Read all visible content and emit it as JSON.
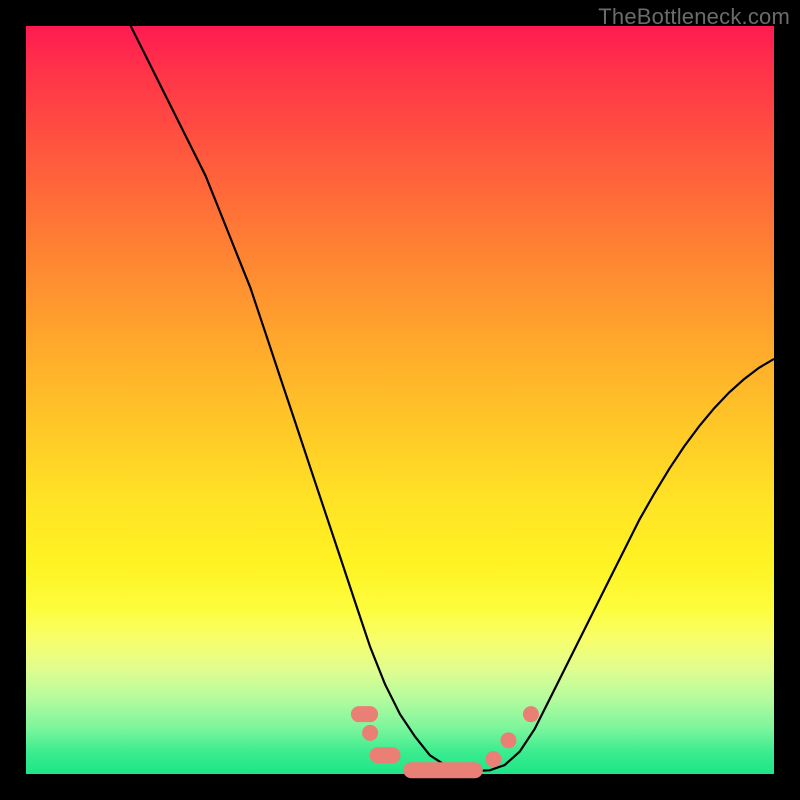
{
  "watermark": "TheBottleneck.com",
  "chart_data": {
    "type": "line",
    "title": "",
    "xlabel": "",
    "ylabel": "",
    "xlim": [
      0,
      100
    ],
    "ylim": [
      0,
      100
    ],
    "series": [
      {
        "name": "curve",
        "x": [
          14,
          16,
          18,
          20,
          22,
          24,
          26,
          28,
          30,
          32,
          34,
          36,
          38,
          40,
          42,
          44,
          46,
          48,
          50,
          52,
          54,
          56,
          58,
          60,
          62,
          64,
          66,
          68,
          70,
          72,
          74,
          76,
          78,
          80,
          82,
          84,
          86,
          88,
          90,
          92,
          94,
          96,
          98,
          100
        ],
        "values": [
          100,
          96,
          92,
          88,
          84,
          80,
          75,
          70,
          65,
          59,
          53,
          47,
          41,
          35,
          29,
          23,
          17,
          12,
          8,
          5,
          2.5,
          1.2,
          0.6,
          0.4,
          0.5,
          1.2,
          3,
          6,
          10,
          14,
          18,
          22,
          26,
          30,
          34,
          37.5,
          40.8,
          43.8,
          46.5,
          48.9,
          51.0,
          52.8,
          54.3,
          55.5
        ]
      }
    ],
    "markers": [
      {
        "shape": "capsule",
        "x0": 51.5,
        "x1": 60.0,
        "y": 0.5
      },
      {
        "shape": "capsule",
        "x0": 47.0,
        "x1": 49.0,
        "y": 2.5
      },
      {
        "shape": "dot",
        "x": 46.0,
        "y": 5.5
      },
      {
        "shape": "capsule",
        "x0": 44.5,
        "x1": 46.0,
        "y": 8.0
      },
      {
        "shape": "dot",
        "x": 62.5,
        "y": 2.0
      },
      {
        "shape": "dot",
        "x": 64.5,
        "y": 4.5
      },
      {
        "shape": "dot",
        "x": 67.5,
        "y": 8.0
      }
    ],
    "marker_color": "#e97f75",
    "curve_color": "#000000",
    "background_gradient": [
      "#ff1a52",
      "#ff8233",
      "#ffe425",
      "#1ce687"
    ]
  }
}
